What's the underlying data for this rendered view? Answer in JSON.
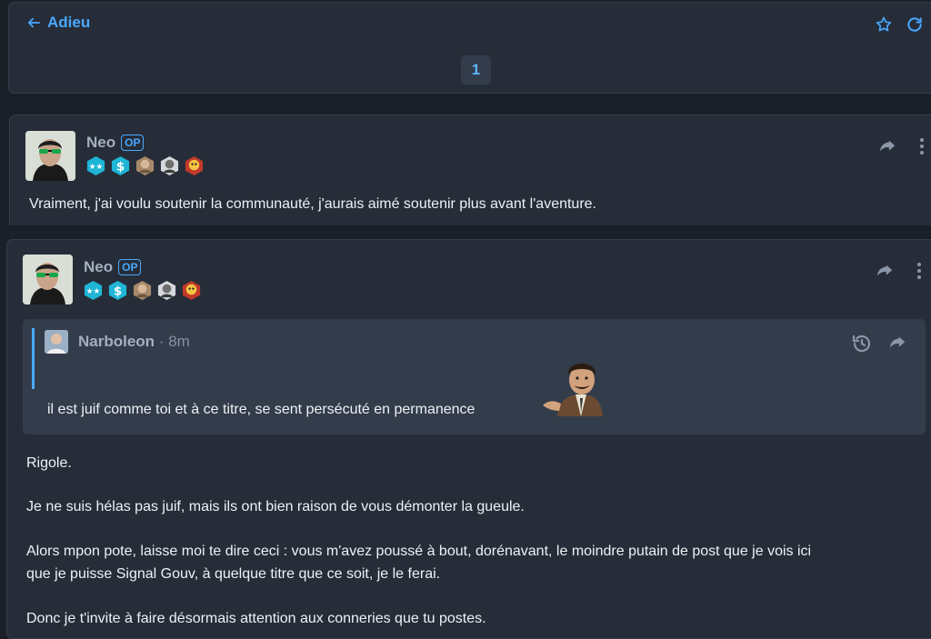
{
  "header": {
    "back_label": "Adieu",
    "current_page": "1",
    "icons": [
      "arrow-left-icon",
      "star-icon",
      "refresh-icon"
    ]
  },
  "posts": [
    {
      "author": "Neo",
      "op_label": "OP",
      "body": "Vraiment, j'ai voulu soutenir la communauté, j'aurais aimé soutenir plus avant l'aventure."
    },
    {
      "author": "Neo",
      "op_label": "OP",
      "quote": {
        "author": "Narboleon",
        "separator": "·",
        "age": "8m",
        "text": "il est juif comme toi et à ce titre, se sent persécuté en permanence"
      },
      "paragraphs": [
        "Rigole.",
        "Je ne suis hélas pas juif, mais ils ont bien raison de vous démonter la gueule.",
        "Alors mpon pote, laisse moi te dire ceci : vous m'avez poussé à bout, dorénavant, le moindre putain de post que je vois ici",
        "que je puisse Signal Gouv, à quelque titre que ce soit, je le ferai.",
        "Donc je t'invite à faire désormais attention aux conneries que tu postes."
      ]
    }
  ],
  "colors": {
    "background": "#1b2028",
    "card": "#262d38",
    "quote": "#333c4a",
    "accent": "#4aa8ff",
    "muted_text": "#a3afc0"
  }
}
